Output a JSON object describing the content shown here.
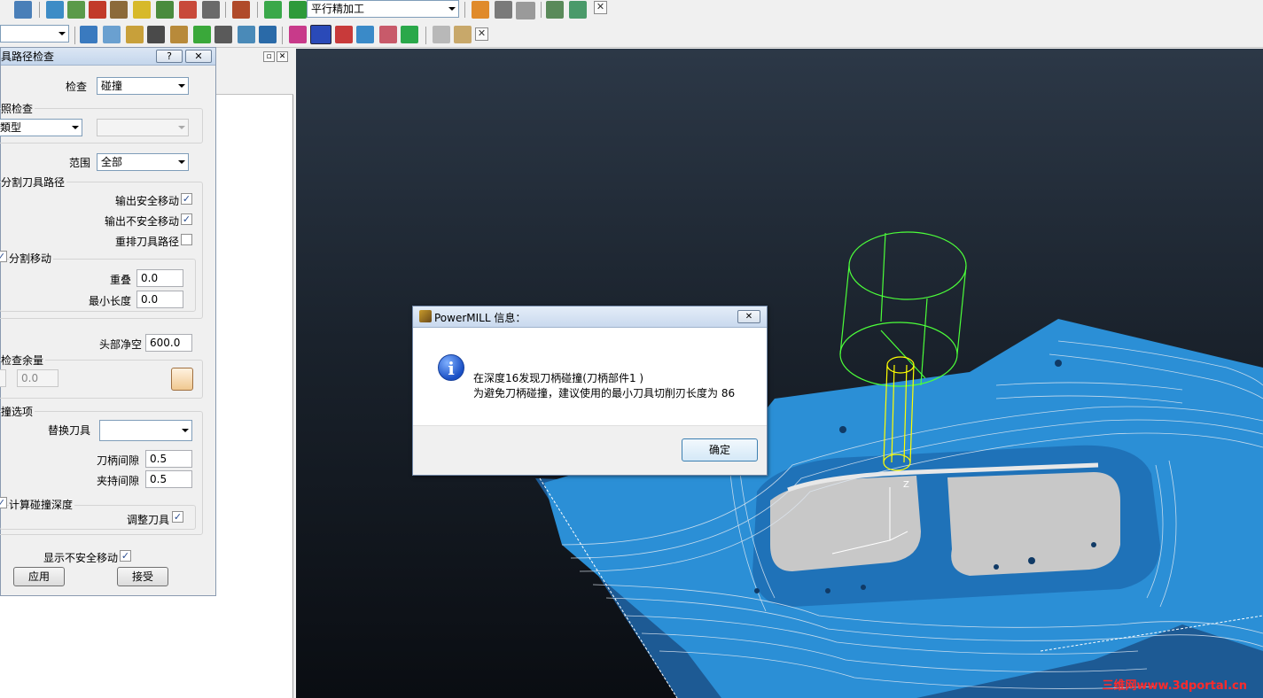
{
  "toolbar": {
    "strategy_combo": "平行精加工",
    "colors": {
      "accent": "#2b8fd6"
    }
  },
  "dialog": {
    "title": "具路径检查",
    "help_btn": "?",
    "close_btn": "✕",
    "check_label": "检查",
    "check_value": "碰撞",
    "group_check": "照检查",
    "type_value": "類型",
    "range_label": "范围",
    "range_value": "全部",
    "group_split": "分割刀具路径",
    "out_safe": "输出安全移动",
    "out_unsafe": "输出不安全移动",
    "reorder": "重排刀具路径",
    "group_splitmove": "分割移动",
    "overlap_label": "重叠",
    "overlap_value": "0.0",
    "minlen_label": "最小长度",
    "minlen_value": "0.0",
    "head_clear_label": "头部净空",
    "head_clear_value": "600.0",
    "group_allowance": "检查余量",
    "allowance_value": "0.0",
    "group_collision": "撞选项",
    "replace_tool_label": "替换刀具",
    "shank_clear_label": "刀柄间隙",
    "shank_clear_value": "0.5",
    "holder_clear_label": "夹持间隙",
    "holder_clear_value": "0.5",
    "calc_depth": "计算碰撞深度",
    "adjust_tool": "调整刀具",
    "show_unsafe": "显示不安全移动",
    "apply_btn": "应用",
    "accept_btn": "接受"
  },
  "message": {
    "title": "PowerMILL 信息：",
    "line1": "在深度16发现刀柄碰撞(刀柄部件1 )",
    "line2": "为避免刀柄碰撞，建议使用的最小刀具切削刃长度为 86",
    "ok_btn": "确定",
    "close_btn": "✕"
  },
  "viewport": {
    "watermark": "三维网www.3dportal.cn",
    "axis_label": "Z"
  }
}
